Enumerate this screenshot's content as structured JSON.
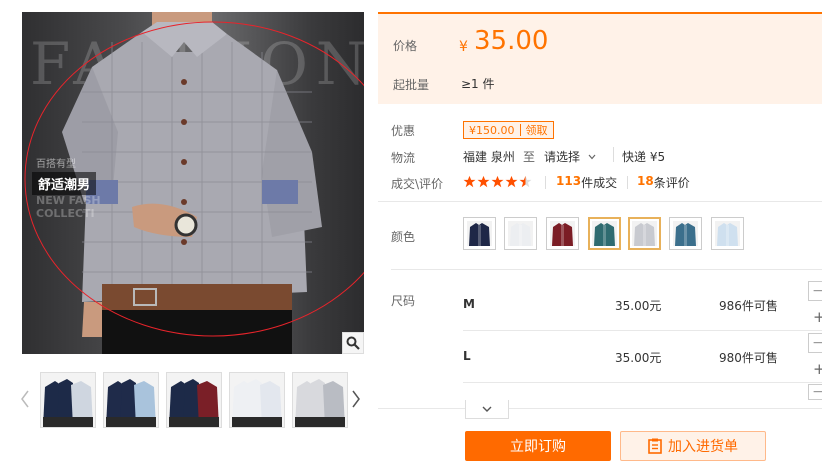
{
  "gallery": {
    "brand_text": "FASHIONMAN",
    "tag_small": "百搭有型",
    "tag_main": "舒适潮男",
    "tag_en_1": "NEW FASH",
    "tag_en_2": "COLLECTI",
    "zoom_icon": "search-icon",
    "prev_icon": "chevron-left-icon",
    "next_icon": "chevron-right-icon",
    "thumbnails": [
      {
        "shirt_colors": [
          "#1d2a48",
          "#cfd6e0"
        ]
      },
      {
        "shirt_colors": [
          "#1f2b4a",
          "#a9c3dc"
        ]
      },
      {
        "shirt_colors": [
          "#1d2a48",
          "#7a1f27"
        ]
      },
      {
        "shirt_colors": [
          "#eef0f3",
          "#e3e7ee"
        ]
      },
      {
        "shirt_colors": [
          "#d8d9dd",
          "#b9bcc3"
        ]
      }
    ]
  },
  "price": {
    "label": "价格",
    "currency": "¥",
    "value": "35.00",
    "moq_label": "起批量",
    "moq_value": "≥1 件"
  },
  "promo": {
    "label": "优惠",
    "coupon_amount": "¥150.00",
    "coupon_action": "领取"
  },
  "shipping": {
    "label": "物流",
    "from": "福建 泉州",
    "to_word": "至",
    "select_placeholder": "请选择",
    "method": "快递 ¥5"
  },
  "reviews": {
    "label": "成交\\评价",
    "rating": 4.5,
    "deals_count": "113",
    "deals_suffix": "件成交",
    "review_count": "18",
    "review_suffix": "条评价"
  },
  "colors": {
    "label": "颜色",
    "selected_indices": [
      3,
      4
    ],
    "swatches": [
      {
        "bg": "#1e2747"
      },
      {
        "bg": "#eceef1"
      },
      {
        "bg": "#7b1d25"
      },
      {
        "bg": "#2f6b70"
      },
      {
        "bg": "#c8cad0"
      },
      {
        "bg": "#3b6f8c"
      },
      {
        "bg": "#cfe0ef"
      }
    ]
  },
  "sizes": {
    "label": "尺码",
    "rows": [
      {
        "size": "M",
        "price": "35.00元",
        "stock": "986件可售"
      },
      {
        "size": "L",
        "price": "35.00元",
        "stock": "980件可售"
      }
    ]
  },
  "actions": {
    "buy_label": "立即订购",
    "cart_label": "加入进货单",
    "cart_icon": "cart-list-icon",
    "more_icon": "chevron-down-icon"
  },
  "accent_color": "#ff7300"
}
